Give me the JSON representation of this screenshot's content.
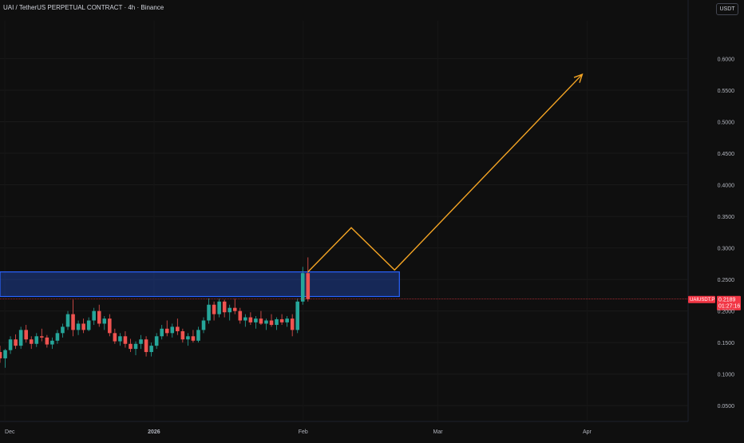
{
  "header": {
    "title": "UAI / TetherUS PERPETUAL CONTRACT · 4h · Binance",
    "currency": "USDT"
  },
  "price_axis": {
    "ticks": [
      "0.6000",
      "0.5500",
      "0.5000",
      "0.4500",
      "0.4000",
      "0.3500",
      "0.3000",
      "0.2500",
      "0.2000",
      "0.1500",
      "0.1000",
      "0.0500"
    ]
  },
  "time_axis": {
    "ticks": [
      "Dec",
      "2026",
      "Feb",
      "Mar",
      "Apr"
    ]
  },
  "last_price": {
    "symbol": "UAIUSDT.P",
    "price": "0.2189",
    "countdown": "01:27:16",
    "color": "#f23645"
  },
  "colors": {
    "up": "#26a69a",
    "down": "#ef5350",
    "zone": "#2962ff",
    "projection": "#f5a524"
  },
  "chart_data": {
    "type": "candlestick",
    "symbol": "UAIUSDT.P",
    "interval": "4h",
    "ylim": [
      0.025,
      0.66
    ],
    "x_range": [
      "2025-11-30",
      "2026-04-22"
    ],
    "ohlc_summary": {
      "start": "2025-11-30",
      "end": "2026-02-02",
      "low": 0.11,
      "high": 0.285,
      "last": 0.2189
    },
    "candles": [
      [
        0.135,
        0.145,
        0.118,
        0.125
      ],
      [
        0.125,
        0.14,
        0.11,
        0.138
      ],
      [
        0.138,
        0.16,
        0.132,
        0.155
      ],
      [
        0.155,
        0.163,
        0.14,
        0.145
      ],
      [
        0.145,
        0.175,
        0.14,
        0.17
      ],
      [
        0.17,
        0.178,
        0.15,
        0.155
      ],
      [
        0.155,
        0.16,
        0.14,
        0.148
      ],
      [
        0.148,
        0.165,
        0.143,
        0.16
      ],
      [
        0.16,
        0.172,
        0.152,
        0.158
      ],
      [
        0.158,
        0.162,
        0.142,
        0.147
      ],
      [
        0.147,
        0.158,
        0.14,
        0.153
      ],
      [
        0.153,
        0.17,
        0.148,
        0.165
      ],
      [
        0.165,
        0.18,
        0.158,
        0.175
      ],
      [
        0.175,
        0.2,
        0.17,
        0.195
      ],
      [
        0.195,
        0.218,
        0.16,
        0.17
      ],
      [
        0.17,
        0.185,
        0.162,
        0.18
      ],
      [
        0.18,
        0.188,
        0.165,
        0.17
      ],
      [
        0.17,
        0.19,
        0.168,
        0.185
      ],
      [
        0.185,
        0.205,
        0.178,
        0.2
      ],
      [
        0.2,
        0.21,
        0.175,
        0.18
      ],
      [
        0.18,
        0.192,
        0.17,
        0.188
      ],
      [
        0.188,
        0.195,
        0.16,
        0.165
      ],
      [
        0.165,
        0.172,
        0.148,
        0.152
      ],
      [
        0.152,
        0.165,
        0.145,
        0.16
      ],
      [
        0.16,
        0.168,
        0.142,
        0.148
      ],
      [
        0.148,
        0.156,
        0.135,
        0.14
      ],
      [
        0.14,
        0.152,
        0.13,
        0.148
      ],
      [
        0.148,
        0.162,
        0.14,
        0.155
      ],
      [
        0.155,
        0.16,
        0.128,
        0.135
      ],
      [
        0.135,
        0.15,
        0.128,
        0.145
      ],
      [
        0.145,
        0.165,
        0.14,
        0.16
      ],
      [
        0.16,
        0.178,
        0.155,
        0.172
      ],
      [
        0.172,
        0.185,
        0.16,
        0.165
      ],
      [
        0.165,
        0.18,
        0.158,
        0.175
      ],
      [
        0.175,
        0.188,
        0.162,
        0.168
      ],
      [
        0.168,
        0.172,
        0.15,
        0.155
      ],
      [
        0.155,
        0.165,
        0.145,
        0.16
      ],
      [
        0.16,
        0.17,
        0.15,
        0.153
      ],
      [
        0.153,
        0.175,
        0.15,
        0.17
      ],
      [
        0.17,
        0.19,
        0.165,
        0.185
      ],
      [
        0.185,
        0.22,
        0.18,
        0.21
      ],
      [
        0.21,
        0.215,
        0.185,
        0.195
      ],
      [
        0.195,
        0.22,
        0.19,
        0.215
      ],
      [
        0.215,
        0.218,
        0.19,
        0.198
      ],
      [
        0.198,
        0.21,
        0.185,
        0.205
      ],
      [
        0.205,
        0.22,
        0.195,
        0.2
      ],
      [
        0.2,
        0.205,
        0.18,
        0.185
      ],
      [
        0.185,
        0.195,
        0.175,
        0.19
      ],
      [
        0.19,
        0.198,
        0.178,
        0.182
      ],
      [
        0.182,
        0.192,
        0.172,
        0.188
      ],
      [
        0.188,
        0.2,
        0.178,
        0.18
      ],
      [
        0.18,
        0.188,
        0.17,
        0.185
      ],
      [
        0.185,
        0.195,
        0.175,
        0.178
      ],
      [
        0.178,
        0.19,
        0.17,
        0.187
      ],
      [
        0.187,
        0.195,
        0.178,
        0.182
      ],
      [
        0.182,
        0.192,
        0.175,
        0.188
      ],
      [
        0.188,
        0.195,
        0.16,
        0.17
      ],
      [
        0.17,
        0.22,
        0.165,
        0.215
      ],
      [
        0.215,
        0.27,
        0.21,
        0.26
      ],
      [
        0.26,
        0.285,
        0.215,
        0.219
      ]
    ],
    "annotations": {
      "resistance_zone": {
        "from_date": "2025-11-30",
        "to_date": "2026-02-21",
        "low": 0.223,
        "high": 0.262
      },
      "projection_path": [
        {
          "date": "2026-02-02",
          "price": 0.262
        },
        {
          "date": "2026-02-11",
          "price": 0.332
        },
        {
          "date": "2026-02-20",
          "price": 0.265
        },
        {
          "date": "2026-03-31",
          "price": 0.575
        }
      ],
      "last_price_line": 0.2189
    }
  }
}
